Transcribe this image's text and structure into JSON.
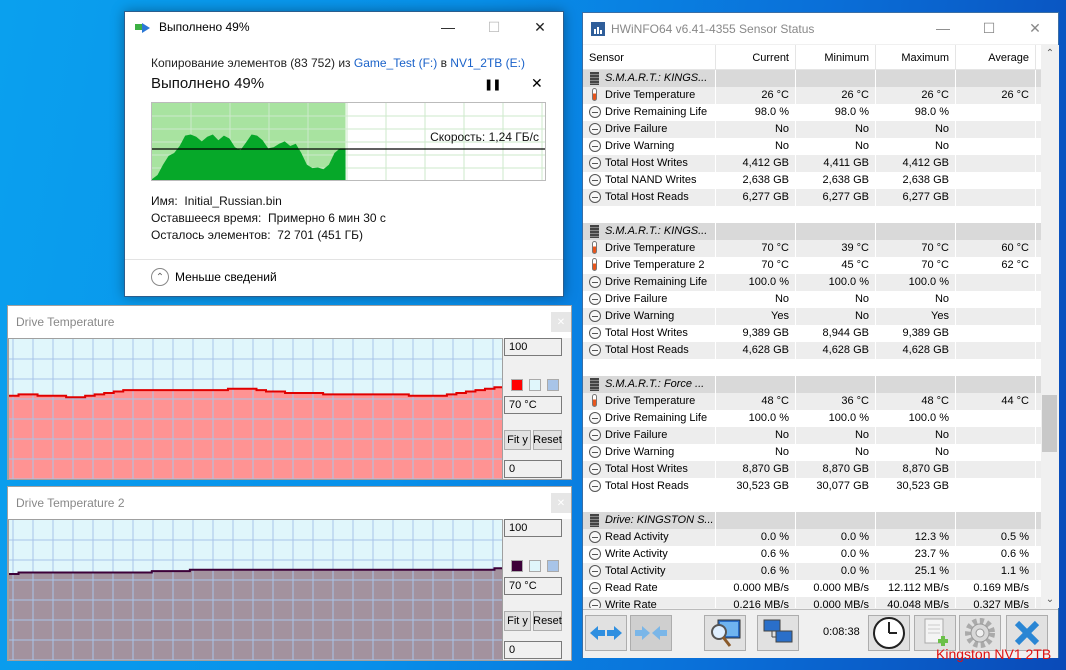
{
  "copy_dialog": {
    "title": "Выполнено 49%",
    "copy_prefix": "Копирование элементов (83 752) из ",
    "source": "Game_Test (F:)",
    "middle": " в ",
    "destination": "NV1_2TB (E:)",
    "progress_label": "Выполнено 49%",
    "progress_percent": 49,
    "pause_icon": "pause-icon",
    "cancel_icon": "close-icon",
    "speed_label": "Скорость: 1,24 ГБ/с",
    "name_label": "Имя:",
    "name_value": "Initial_Russian.bin",
    "time_label": "Оставшееся время:",
    "time_value": "Примерно 6 мин 30 с",
    "items_label": "Осталось элементов:",
    "items_value": "72 701 (451 ГБ)",
    "less_details": "Меньше сведений",
    "colors": {
      "fill_done": "#a8e3a0",
      "throughput": "#06a829"
    }
  },
  "graph_windows": [
    {
      "title": "Drive Temperature",
      "max_box": "100",
      "current_box": "70 °C",
      "min_box": "0",
      "fit_label": "Fit y",
      "reset_label": "Reset",
      "colors": {
        "line": "#e00000",
        "fill": "#ff9393",
        "bg": "#e0f6fb",
        "grid": "#a8c4e8"
      },
      "series_c": [
        60,
        61,
        61,
        60,
        60,
        60,
        59,
        59,
        60,
        61,
        62,
        63,
        64,
        64,
        64,
        64,
        64,
        64,
        64,
        64,
        64,
        64,
        64,
        65,
        65,
        65,
        64,
        63,
        63,
        62,
        62,
        62,
        62,
        61,
        61,
        61,
        61,
        61,
        61,
        61,
        61,
        61,
        60,
        60,
        60,
        60,
        61,
        62,
        63,
        64,
        65,
        66
      ]
    },
    {
      "title": "Drive Temperature 2",
      "max_box": "100",
      "current_box": "70 °C",
      "min_box": "0",
      "fit_label": "Fit y",
      "reset_label": "Reset",
      "colors": {
        "line": "#3c0038",
        "fill": "#a3929e",
        "bg": "#e0f6fb",
        "grid": "#a8c4e8"
      },
      "series_c": [
        62,
        63,
        63,
        63,
        63,
        63,
        63,
        63,
        63,
        63,
        63,
        63,
        63,
        63,
        63,
        64,
        64,
        64,
        64,
        65,
        65,
        65,
        65,
        65,
        65,
        65,
        65,
        65,
        65,
        65,
        65,
        65,
        65,
        65,
        65,
        65,
        65,
        65,
        65,
        65,
        65,
        65,
        65,
        65,
        65,
        65,
        65,
        65,
        65,
        65,
        65,
        66
      ]
    }
  ],
  "hwinfo": {
    "title": "HWiNFO64 v6.41-4355 Sensor Status",
    "columns": [
      "Sensor",
      "Current",
      "Minimum",
      "Maximum",
      "Average"
    ],
    "rows": [
      {
        "type": "group",
        "name": "S.M.A.R.T.: KINGS..."
      },
      {
        "type": "temp",
        "name": "Drive Temperature",
        "v": [
          "26 °C",
          "26 °C",
          "26 °C",
          "26 °C"
        ]
      },
      {
        "type": "clock",
        "name": "Drive Remaining Life",
        "v": [
          "98.0 %",
          "98.0 %",
          "98.0 %",
          ""
        ]
      },
      {
        "type": "clock",
        "name": "Drive Failure",
        "v": [
          "No",
          "No",
          "No",
          ""
        ]
      },
      {
        "type": "clock",
        "name": "Drive Warning",
        "v": [
          "No",
          "No",
          "No",
          ""
        ]
      },
      {
        "type": "clock",
        "name": "Total Host Writes",
        "v": [
          "4,412 GB",
          "4,411 GB",
          "4,412 GB",
          ""
        ]
      },
      {
        "type": "clock",
        "name": "Total NAND Writes",
        "v": [
          "2,638 GB",
          "2,638 GB",
          "2,638 GB",
          ""
        ]
      },
      {
        "type": "clock",
        "name": "Total Host Reads",
        "v": [
          "6,277 GB",
          "6,277 GB",
          "6,277 GB",
          ""
        ]
      },
      {
        "type": "blank"
      },
      {
        "type": "group",
        "name": "S.M.A.R.T.: KINGS..."
      },
      {
        "type": "temp",
        "name": "Drive Temperature",
        "v": [
          "70 °C",
          "39 °C",
          "70 °C",
          "60 °C"
        ]
      },
      {
        "type": "temp",
        "name": "Drive Temperature 2",
        "v": [
          "70 °C",
          "45 °C",
          "70 °C",
          "62 °C"
        ]
      },
      {
        "type": "clock",
        "name": "Drive Remaining Life",
        "v": [
          "100.0 %",
          "100.0 %",
          "100.0 %",
          ""
        ]
      },
      {
        "type": "clock",
        "name": "Drive Failure",
        "v": [
          "No",
          "No",
          "No",
          ""
        ]
      },
      {
        "type": "clock",
        "name": "Drive Warning",
        "v": [
          "Yes",
          "No",
          "Yes",
          ""
        ]
      },
      {
        "type": "clock",
        "name": "Total Host Writes",
        "v": [
          "9,389 GB",
          "8,944 GB",
          "9,389 GB",
          ""
        ]
      },
      {
        "type": "clock",
        "name": "Total Host Reads",
        "v": [
          "4,628 GB",
          "4,628 GB",
          "4,628 GB",
          ""
        ]
      },
      {
        "type": "blank"
      },
      {
        "type": "group",
        "name": "S.M.A.R.T.: Force ..."
      },
      {
        "type": "temp",
        "name": "Drive Temperature",
        "v": [
          "48 °C",
          "36 °C",
          "48 °C",
          "44 °C"
        ]
      },
      {
        "type": "clock",
        "name": "Drive Remaining Life",
        "v": [
          "100.0 %",
          "100.0 %",
          "100.0 %",
          ""
        ]
      },
      {
        "type": "clock",
        "name": "Drive Failure",
        "v": [
          "No",
          "No",
          "No",
          ""
        ]
      },
      {
        "type": "clock",
        "name": "Drive Warning",
        "v": [
          "No",
          "No",
          "No",
          ""
        ]
      },
      {
        "type": "clock",
        "name": "Total Host Writes",
        "v": [
          "8,870 GB",
          "8,870 GB",
          "8,870 GB",
          ""
        ]
      },
      {
        "type": "clock",
        "name": "Total Host Reads",
        "v": [
          "30,523 GB",
          "30,077 GB",
          "30,523 GB",
          ""
        ]
      },
      {
        "type": "blank"
      },
      {
        "type": "group",
        "name": "Drive: KINGSTON S..."
      },
      {
        "type": "clock",
        "name": "Read Activity",
        "v": [
          "0.0 %",
          "0.0 %",
          "12.3 %",
          "0.5 %"
        ]
      },
      {
        "type": "clock",
        "name": "Write Activity",
        "v": [
          "0.6 %",
          "0.0 %",
          "23.7 %",
          "0.6 %"
        ]
      },
      {
        "type": "clock",
        "name": "Total Activity",
        "v": [
          "0.6 %",
          "0.0 %",
          "25.1 %",
          "1.1 %"
        ]
      },
      {
        "type": "clock",
        "name": "Read Rate",
        "v": [
          "0.000 MB/s",
          "0.000 MB/s",
          "12.112 MB/s",
          "0.169 MB/s"
        ]
      },
      {
        "type": "clock",
        "name": "Write Rate",
        "v": [
          "0.216 MB/s",
          "0.000 MB/s",
          "40.048 MB/s",
          "0.327 MB/s"
        ]
      }
    ],
    "timer": "0:08:38",
    "toolbar_icons": [
      "expand-arrows-icon",
      "collapse-arrows-icon",
      "monitor-search-icon",
      "network-icon",
      "clock-icon",
      "add-report-icon",
      "settings-gear-icon",
      "close-x-icon"
    ]
  },
  "overlay_label": "Kingston NV1 2TB"
}
